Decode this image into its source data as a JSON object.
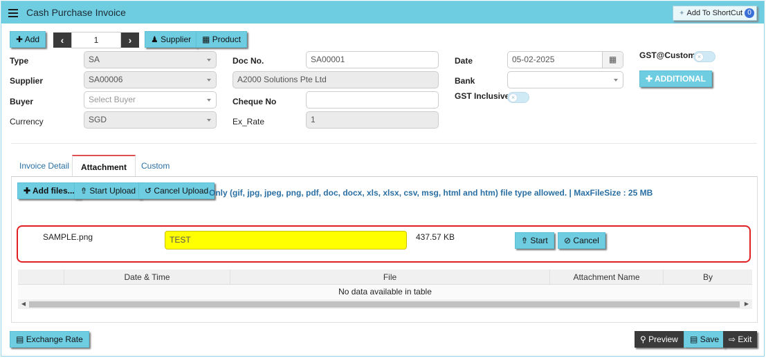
{
  "window": {
    "title": "Cash Purchase Invoice",
    "shortcut_label": "Add To ShortCut",
    "shortcut_count": "0"
  },
  "toolbar": {
    "add_label": "Add",
    "page_value": "1",
    "supplier_label": "Supplier",
    "product_label": "Product"
  },
  "form": {
    "type": {
      "label": "Type",
      "value": "SA"
    },
    "supplier": {
      "label": "Supplier",
      "value": "SA00006"
    },
    "buyer": {
      "label": "Buyer",
      "placeholder": "Select Buyer"
    },
    "currency": {
      "label": "Currency",
      "value": "SGD"
    },
    "doc_no": {
      "label": "Doc No.",
      "value": "SA00001"
    },
    "supplier_name": {
      "value": "A2000 Solutions Pte Ltd"
    },
    "cheque_no": {
      "label": "Cheque No",
      "value": ""
    },
    "ex_rate": {
      "label": "Ex_Rate",
      "value": "1"
    },
    "date": {
      "label": "Date",
      "value": "05-02-2025"
    },
    "bank": {
      "label": "Bank",
      "value": ""
    },
    "gst_inclusive": {
      "label": "GST Inclusive"
    },
    "gst_custom": {
      "label": "GST@Custom"
    },
    "additional_label": "ADDITIONAL"
  },
  "tabs": [
    {
      "label": "Invoice Detail"
    },
    {
      "label": "Attachment"
    },
    {
      "label": "Custom"
    }
  ],
  "attachment": {
    "add_files_label": "Add files...",
    "start_upload_label": "Start Upload",
    "cancel_upload_label": "Cancel Upload",
    "note": "Only (gif, jpg, jpeg, png, pdf, doc, docx, xls, xlsx, csv, msg, html and htm) file type allowed. | MaxFileSize : 25 MB",
    "pending_file": {
      "name": "SAMPLE.png",
      "attachment_name": "TEST",
      "size": "437.57 KB",
      "start_label": "Start",
      "cancel_label": "Cancel"
    },
    "table": {
      "columns": [
        "",
        "Date & Time",
        "File",
        "Attachment Name",
        "By"
      ],
      "empty_text": "No data available in table"
    }
  },
  "footer": {
    "exchange_rate_label": "Exchange Rate",
    "preview_label": "Preview",
    "save_label": "Save",
    "exit_label": "Exit"
  },
  "colors": {
    "accent": "#6fcde2",
    "highlight": "#ffff00",
    "alert_border": "#e02020"
  }
}
